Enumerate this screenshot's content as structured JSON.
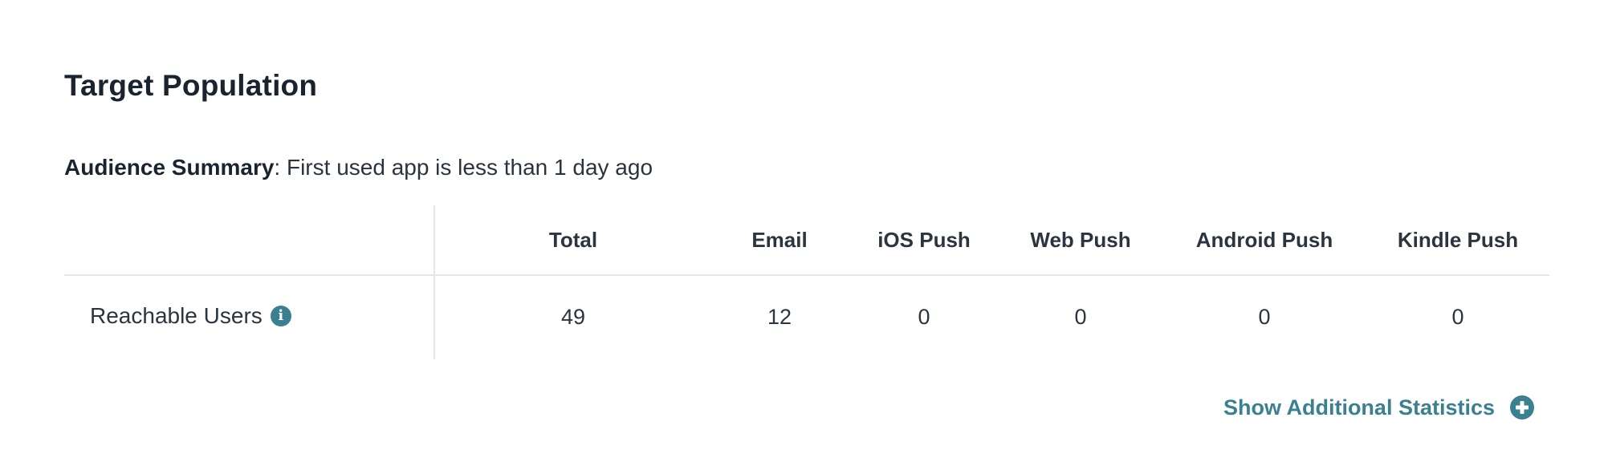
{
  "section": {
    "title": "Target Population"
  },
  "summary": {
    "label": "Audience Summary",
    "separator": ": ",
    "text": "First used app is less than 1 day ago"
  },
  "table": {
    "headers": {
      "total": "Total",
      "email": "Email",
      "ios_push": "iOS Push",
      "web_push": "Web Push",
      "android_push": "Android Push",
      "kindle_push": "Kindle Push"
    },
    "rows": [
      {
        "label": "Reachable Users",
        "info_icon": "info-icon",
        "total": "49",
        "email": "12",
        "ios_push": "0",
        "web_push": "0",
        "android_push": "0",
        "kindle_push": "0"
      }
    ]
  },
  "show_stats": {
    "label": "Show Additional Statistics",
    "icon": "plus-circle-icon"
  },
  "colors": {
    "accent": "#3b8091",
    "text": "#1c2530",
    "divider": "#e4e7ea"
  }
}
